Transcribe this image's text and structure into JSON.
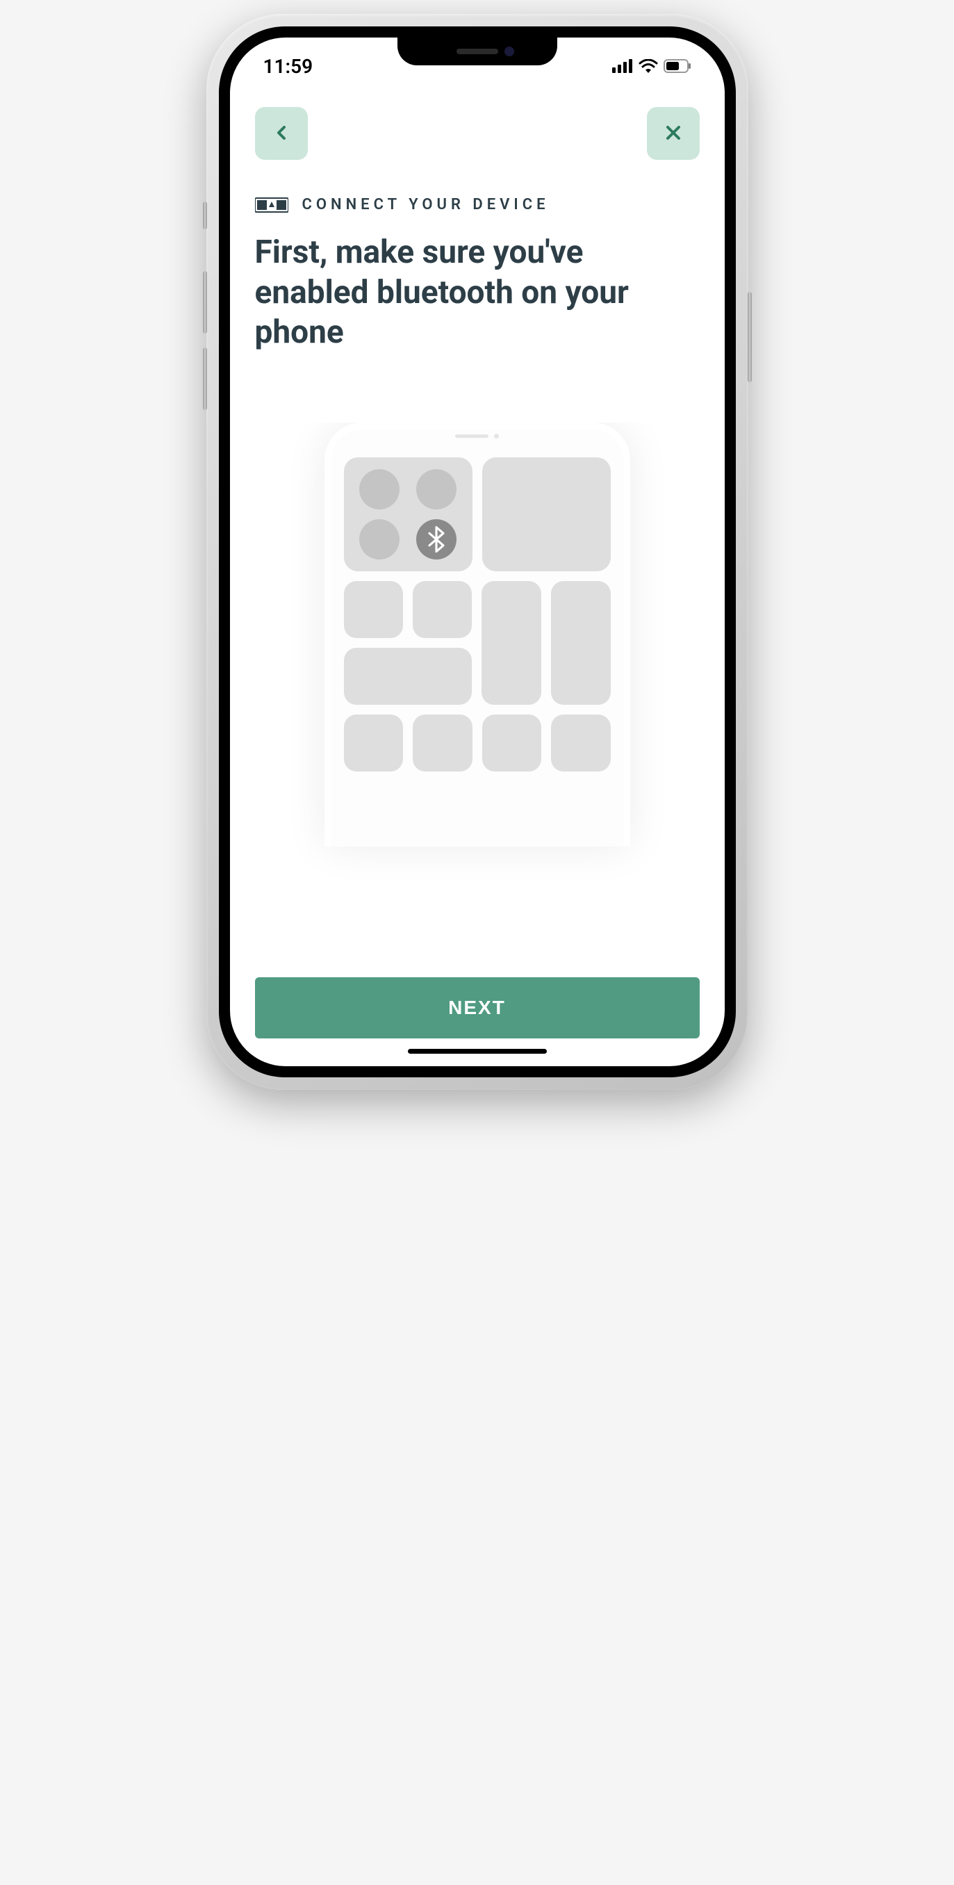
{
  "status": {
    "time": "11:59"
  },
  "nav": {
    "back": "back",
    "close": "close"
  },
  "section": {
    "label": "CONNECT YOUR DEVICE"
  },
  "title": "First, make sure you've enabled bluetooth on your phone",
  "cta": {
    "next": "NEXT"
  },
  "colors": {
    "accent": "#509b82",
    "accent_light": "#cde6db",
    "text_dark": "#2d3e47"
  }
}
